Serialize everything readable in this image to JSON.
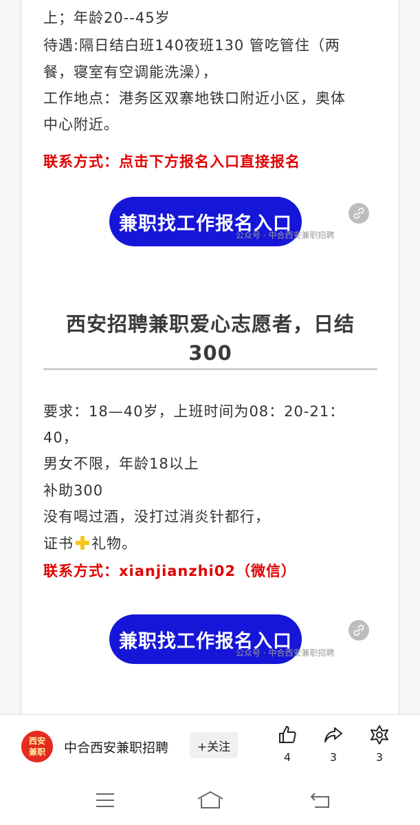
{
  "section1": {
    "line1": "上；年龄20--45岁",
    "line2": "待遇:隔日结白班140夜班130  管吃管住（两",
    "line3": "餐，寝室有空调能洗澡），",
    "line4": "工作地点：港务区双寨地铁口附近小区，奥体",
    "line5": "中心附近。",
    "contact": "联系方式：点击下方报名入口直接报名",
    "button": "兼职找工作报名入口",
    "watermark": "公众号 · 中合西安兼职招聘"
  },
  "section2": {
    "title_line1": "西安招聘兼职爱心志愿者，日结",
    "title_line2": "300",
    "line1": "要求：18—40岁，上班时间为08：20-21：",
    "line2": "40，",
    "line3": "男女不限，年龄18以上",
    "line4": "补助300",
    "line5": "没有喝过酒，没打过消炎针都行，",
    "line6_a": "证书",
    "line6_b": "礼物。",
    "contact": "联系方式：xianjianzhi02（微信）",
    "button": "兼职找工作报名入口",
    "watermark": "公众号 · 中合西安兼职招聘"
  },
  "bottom_bar": {
    "avatar_line1": "西安",
    "avatar_line2": "兼职",
    "account_name": "中合西安兼职招聘",
    "follow_label": "+关注",
    "like_count": "4",
    "share_count": "3",
    "wow_count": "3"
  },
  "colors": {
    "button": "#1616d8",
    "contact": "#e00000",
    "avatar": "#e52b20"
  }
}
